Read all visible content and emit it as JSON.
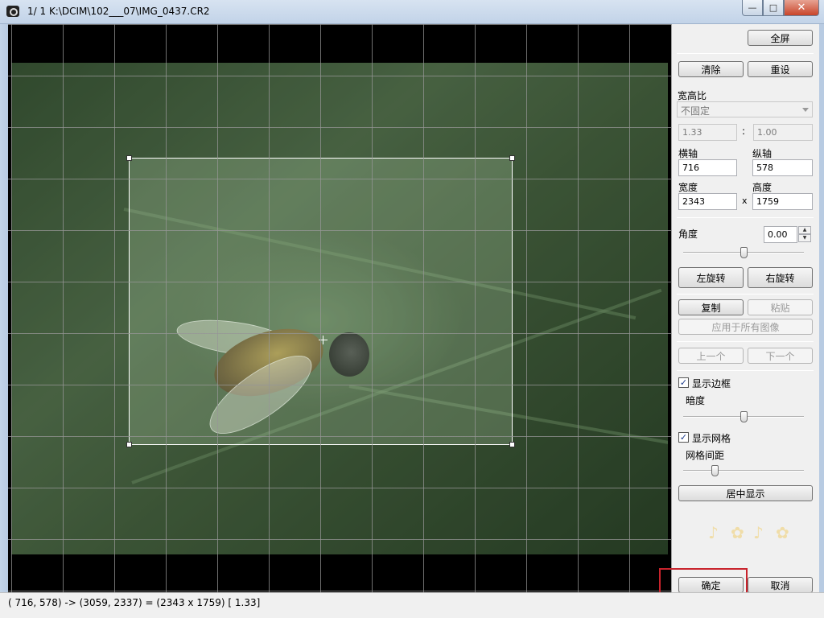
{
  "window": {
    "title": "1/  1  K:\\DCIM\\102___07\\IMG_0437.CR2",
    "minimize_glyph": "—",
    "maximize_glyph": "□",
    "close_glyph": "✕"
  },
  "panel": {
    "fullscreen": "全屏",
    "clear": "清除",
    "reset": "重设",
    "aspect_label": "宽高比",
    "aspect_value": "不固定",
    "ratio_w": "1.33",
    "ratio_colon": ":",
    "ratio_h": "1.00",
    "x_label": "横轴",
    "x_value": "716",
    "y_label": "纵轴",
    "y_value": "578",
    "width_label": "宽度",
    "width_value": "2343",
    "times": "x",
    "height_label": "高度",
    "height_value": "1759",
    "angle_label": "角度",
    "angle_value": "0.00",
    "angle_slider": 0.5,
    "rotate_left": "左旋转",
    "rotate_right": "右旋转",
    "copy": "复制",
    "paste": "粘贴",
    "apply_all": "应用于所有图像",
    "prev": "上一个",
    "next": "下一个",
    "show_border": "显示边框",
    "show_border_checked": true,
    "darkness_label": "暗度",
    "darkness_slider": 0.5,
    "show_grid": "显示网格",
    "show_grid_checked": true,
    "grid_spacing_label": "网格间距",
    "grid_spacing_slider": 0.25,
    "center_display": "居中显示",
    "ok": "确定",
    "cancel": "取消"
  },
  "status": {
    "text": "( 716,  578) -> (3059, 2337) = (2343 x 1759) [ 1.33]"
  },
  "icons": {
    "app": "camera-icon",
    "check": "✓",
    "spin_up": "▲",
    "spin_down": "▼"
  }
}
